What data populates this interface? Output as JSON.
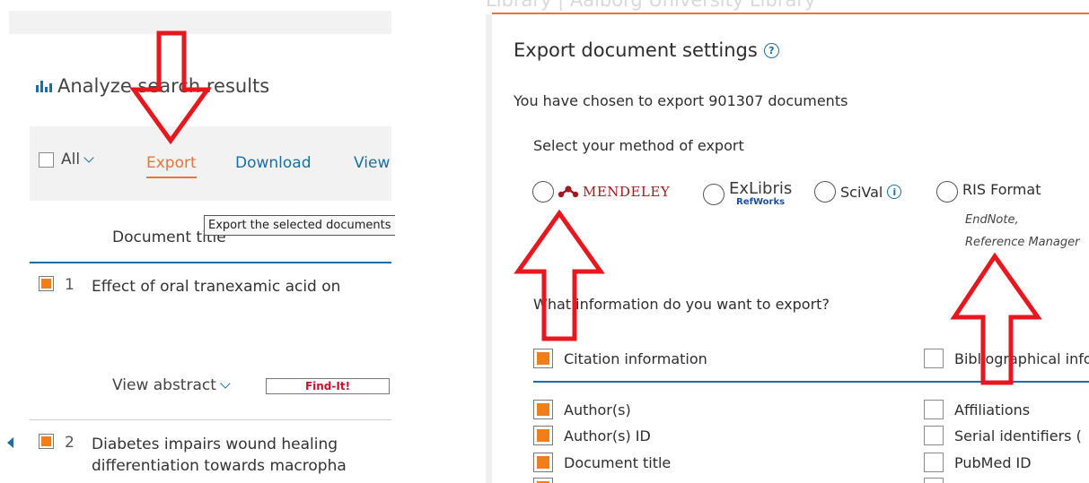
{
  "left_panel": {
    "analyze_title": "Analyze search results",
    "toolbar": {
      "all_label": "All",
      "export_label": "Export",
      "download_label": "Download",
      "view_label": "View"
    },
    "tooltip": "Export the selected documents",
    "column_header": "Document title",
    "results": [
      {
        "number": "1",
        "title": "Effect of oral tranexamic acid on",
        "checked": true
      },
      {
        "number": "2",
        "title_line1": "Diabetes impairs wound healing",
        "title_line2": "differentiation towards macropha",
        "checked": true
      }
    ],
    "view_abstract_label": "View abstract",
    "findit_label": "Find-It!"
  },
  "dialog": {
    "faded_header": "Library | Aalborg University Library",
    "title": "Export document settings",
    "subtitle": "You have chosen to export 901307 documents",
    "method_label": "Select your method of export",
    "methods": [
      {
        "name": "MENDELEY"
      },
      {
        "name": "ExLibris",
        "subname": "RefWorks"
      },
      {
        "name": "SciVal"
      },
      {
        "name": "RIS Format",
        "sub1": "EndNote,",
        "sub2": "Reference Manager"
      }
    ],
    "question": "What information do you want to export?",
    "sections": {
      "citation": "Citation information",
      "bibliographical": "Bibliographical information"
    },
    "citation_fields": [
      "Author(s)",
      "Author(s) ID",
      "Document title"
    ],
    "bibliographical_fields": [
      "Affiliations",
      "Serial identifiers (",
      "PubMed ID"
    ]
  },
  "colors": {
    "accent_blue": "#1b6fa6",
    "accent_orange": "#f07f1b",
    "annotation_red": "#e8161d",
    "mendeley_red": "#a3191c"
  }
}
